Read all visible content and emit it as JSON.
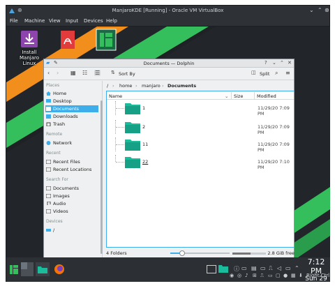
{
  "window": {
    "title": "ManjaroKDE [Running] - Oracle VM VirtualBox"
  },
  "menu": [
    "File",
    "Machine",
    "View",
    "Input",
    "Devices",
    "Help"
  ],
  "desktop_icons": [
    {
      "label": "Install Manjaro Linux",
      "icon": "install-icon"
    },
    {
      "label": "",
      "icon": "pdf-icon"
    },
    {
      "label": "",
      "icon": "manjaro-app-icon"
    }
  ],
  "dolphin": {
    "title": "Documents — Dolphin",
    "toolbar": {
      "sort_label": "Sort By",
      "split_label": "Split"
    },
    "places": {
      "sections": [
        {
          "header": "Places",
          "items": [
            {
              "label": "Home",
              "icon": "home-icon"
            },
            {
              "label": "Desktop",
              "icon": "desktop-icon"
            },
            {
              "label": "Documents",
              "icon": "documents-icon",
              "selected": true
            },
            {
              "label": "Downloads",
              "icon": "downloads-icon"
            },
            {
              "label": "Trash",
              "icon": "trash-icon"
            }
          ]
        },
        {
          "header": "Remote",
          "items": [
            {
              "label": "Network",
              "icon": "network-icon"
            }
          ]
        },
        {
          "header": "Recent",
          "items": [
            {
              "label": "Recent Files",
              "icon": "recent-files-icon"
            },
            {
              "label": "Recent Locations",
              "icon": "recent-locations-icon"
            }
          ]
        },
        {
          "header": "Search For",
          "items": [
            {
              "label": "Documents",
              "icon": "documents-icon"
            },
            {
              "label": "Images",
              "icon": "images-icon"
            },
            {
              "label": "Audio",
              "icon": "audio-icon"
            },
            {
              "label": "Videos",
              "icon": "videos-icon"
            }
          ]
        },
        {
          "header": "Devices",
          "items": [
            {
              "label": "/",
              "icon": "drive-icon"
            }
          ]
        }
      ]
    },
    "breadcrumb": [
      "/",
      "home",
      "manjaro",
      "Documents"
    ],
    "columns": {
      "name": "Name",
      "size": "Size",
      "modified": "Modified"
    },
    "files": [
      {
        "name": "1",
        "modified": "11/29/20 7:09 PM"
      },
      {
        "name": "2",
        "modified": "11/29/20 7:09 PM"
      },
      {
        "name": "11",
        "modified": "11/29/20 7:09 PM"
      },
      {
        "name": "22",
        "modified": "11/29/20 7:10 PM"
      }
    ],
    "status": {
      "count": "4 Folders",
      "free": "2.8 GiB free",
      "zoom_fraction": 0.2,
      "space_used_fraction": 0.55
    }
  },
  "taskbar": {
    "clock_time": "7:12 PM",
    "clock_date": "Sun 29",
    "host_key": "Right Ctrl"
  },
  "colors": {
    "accent": "#3daee9",
    "manjaro_green": "#35bf5c",
    "folder": "#1abc9c",
    "orange": "#f67400"
  }
}
